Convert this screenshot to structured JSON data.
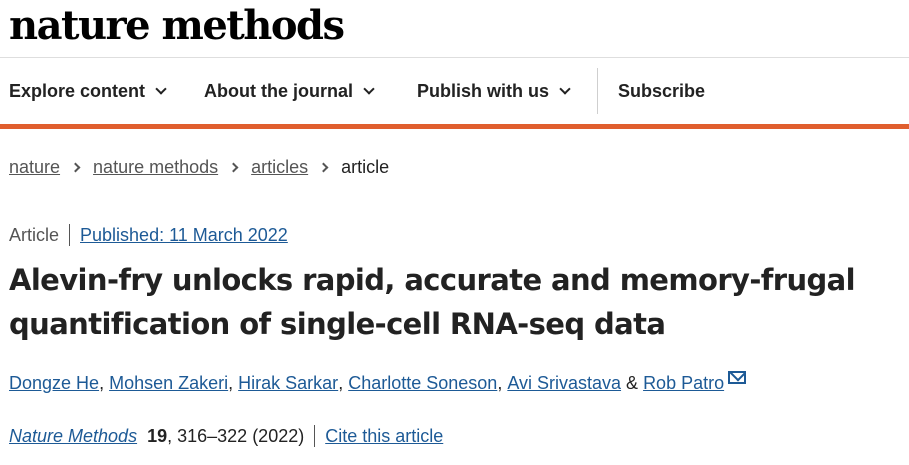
{
  "header": {
    "logo": "nature methods"
  },
  "nav": {
    "items": [
      {
        "label": "Explore content",
        "dropdown": true
      },
      {
        "label": "About the journal",
        "dropdown": true
      },
      {
        "label": "Publish with us",
        "dropdown": true
      },
      {
        "label": "Subscribe",
        "dropdown": false
      }
    ]
  },
  "colors": {
    "accent": "#e05e2e",
    "link": "#1d5a96",
    "text": "#222222",
    "muted": "#555555"
  },
  "breadcrumb": {
    "items": [
      "nature",
      "nature methods",
      "articles"
    ],
    "current": "article"
  },
  "meta": {
    "type": "Article",
    "published": "Published: 11 March 2022"
  },
  "title": "Alevin-fry unlocks rapid, accurate and memory-frugal quantification of single-cell RNA-seq data",
  "authors": {
    "names": [
      "Dongze He",
      "Mohsen Zakeri",
      "Hirak Sarkar",
      "Charlotte Soneson",
      "Avi Srivastava",
      "Rob Patro"
    ],
    "sep": ", ",
    "and": " & ",
    "contact_icon": "mail-icon"
  },
  "citation": {
    "journal": "Nature Methods",
    "volume": "19",
    "pages": ", 316–322 (2022)",
    "cite_label": "Cite this article"
  }
}
